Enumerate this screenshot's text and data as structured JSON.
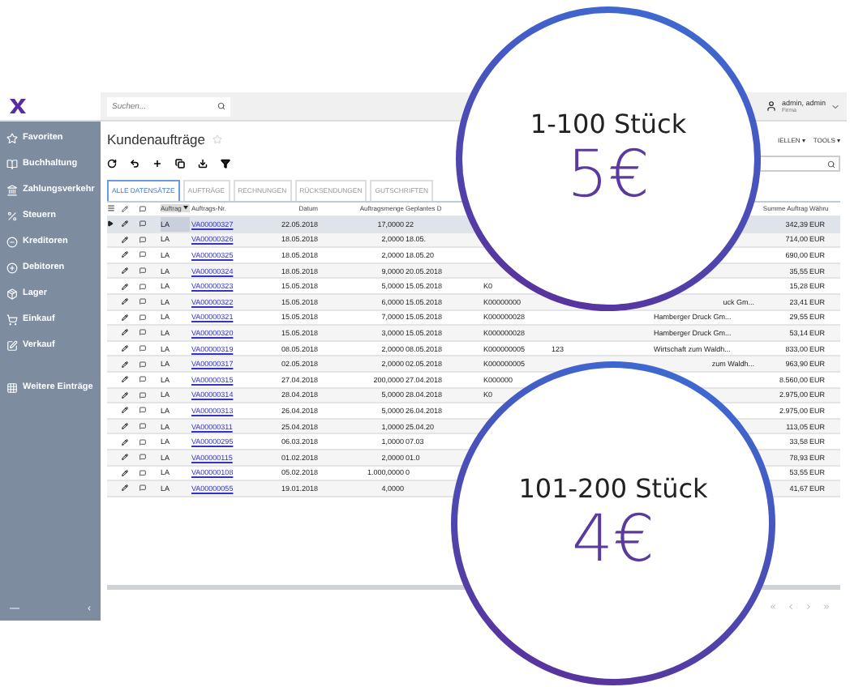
{
  "topbar": {
    "search": {
      "placeholder": "Suchen..."
    },
    "user": {
      "name": "admin, admin",
      "company": "Firma"
    }
  },
  "sidebar": {
    "items": [
      {
        "label": "Favoriten"
      },
      {
        "label": "Buchhaltung"
      },
      {
        "label": "Zahlungsverkehr"
      },
      {
        "label": "Steuern"
      },
      {
        "label": "Kreditoren"
      },
      {
        "label": "Debitoren"
      },
      {
        "label": "Lager"
      },
      {
        "label": "Einkauf"
      },
      {
        "label": "Verkauf"
      },
      {
        "label": "Weitere Einträge"
      }
    ],
    "footer": {
      "minimize": "—",
      "collapse": "‹"
    }
  },
  "page": {
    "title": "Kundenaufträge",
    "menus": [
      "IELLEN ▾",
      "TOOLS ▾"
    ]
  },
  "tabs": [
    {
      "label": "ALLE DATENSÄTZE",
      "selected": true
    },
    {
      "label": "AUFTRÄGE",
      "selected": false
    },
    {
      "label": "RECHNUNGEN",
      "selected": false
    },
    {
      "label": "RÜCKSENDUNGEN",
      "selected": false
    },
    {
      "label": "GUTSCHRIFTEN",
      "selected": false
    }
  ],
  "table": {
    "columns": [
      "Auftrag",
      "Auftrags-Nr.",
      "Datum",
      "Auftragsmenge",
      "Geplantes D",
      "Summe Auftrag",
      "Währu"
    ],
    "rows": [
      {
        "selected": true,
        "type": "LA",
        "nr": "VA00000327",
        "datum": "22.05.2018",
        "menge": "17,0000",
        "geplant": "22",
        "summe": "342,39",
        "waehrung": "EUR"
      },
      {
        "selected": false,
        "type": "LA",
        "nr": "VA00000326",
        "datum": "18.05.2018",
        "menge": "2,0000",
        "geplant": "18.05.",
        "summe": "714,00",
        "waehrung": "EUR"
      },
      {
        "selected": false,
        "type": "LA",
        "nr": "VA00000325",
        "datum": "18.05.2018",
        "menge": "2,0000",
        "geplant": "18.05.20",
        "summe": "690,00",
        "waehrung": "EUR"
      },
      {
        "selected": false,
        "type": "LA",
        "nr": "VA00000324",
        "datum": "18.05.2018",
        "menge": "9,0000",
        "geplant": "20.05.2018",
        "summe": "35,55",
        "waehrung": "EUR"
      },
      {
        "selected": false,
        "type": "LA",
        "nr": "VA00000323",
        "datum": "15.05.2018",
        "menge": "5,0000",
        "geplant": "15.05.2018",
        "kundennr": "K0",
        "summe": "15,28",
        "waehrung": "EUR"
      },
      {
        "selected": false,
        "type": "LA",
        "nr": "VA00000322",
        "datum": "15.05.2018",
        "menge": "6,0000",
        "geplant": "15.05.2018",
        "kundennr": "K00000000",
        "kunde": "uck Gm...",
        "summe": "23,41",
        "waehrung": "EUR"
      },
      {
        "selected": false,
        "type": "LA",
        "nr": "VA00000321",
        "datum": "15.05.2018",
        "menge": "7,0000",
        "geplant": "15.05.2018",
        "kundennr": "K000000028",
        "kunde": "Hamberger Druck Gm...",
        "summe": "29,55",
        "waehrung": "EUR"
      },
      {
        "selected": false,
        "type": "LA",
        "nr": "VA00000320",
        "datum": "15.05.2018",
        "menge": "3,0000",
        "geplant": "15.05.2018",
        "kundennr": "K000000028",
        "kunde": "Hamberger Druck Gm...",
        "summe": "53,14",
        "waehrung": "EUR"
      },
      {
        "selected": false,
        "type": "LA",
        "nr": "VA00000319",
        "datum": "08.05.2018",
        "menge": "2,0000",
        "geplant": "08.05.2018",
        "kundennr": "K000000005",
        "ref": "123",
        "kunde": "Wirtschaft zum Waldh...",
        "summe": "833,00",
        "waehrung": "EUR"
      },
      {
        "selected": false,
        "type": "LA",
        "nr": "VA00000317",
        "datum": "02.05.2018",
        "menge": "2,0000",
        "geplant": "02.05.2018",
        "kundennr": "K000000005",
        "kunde": "zum Waldh...",
        "summe": "963,90",
        "waehrung": "EUR"
      },
      {
        "selected": false,
        "type": "LA",
        "nr": "VA00000315",
        "datum": "27.04.2018",
        "menge": "200,0000",
        "geplant": "27.04.2018",
        "kundennr": "K000000",
        "summe": "8.560,00",
        "waehrung": "EUR"
      },
      {
        "selected": false,
        "type": "LA",
        "nr": "VA00000314",
        "datum": "28.04.2018",
        "menge": "5,0000",
        "geplant": "28.04.2018",
        "kundennr": "K0",
        "summe": "2.975,00",
        "waehrung": "EUR"
      },
      {
        "selected": false,
        "type": "LA",
        "nr": "VA00000313",
        "datum": "26.04.2018",
        "menge": "5,0000",
        "geplant": "26.04.2018",
        "summe": "2.975,00",
        "waehrung": "EUR"
      },
      {
        "selected": false,
        "type": "LA",
        "nr": "VA00000311",
        "datum": "25.04.2018",
        "menge": "1,0000",
        "geplant": "25.04.20",
        "summe": "113,05",
        "waehrung": "EUR"
      },
      {
        "selected": false,
        "type": "LA",
        "nr": "VA00000295",
        "datum": "06.03.2018",
        "menge": "1,0000",
        "geplant": "07.03",
        "summe": "33,58",
        "waehrung": "EUR"
      },
      {
        "selected": false,
        "type": "LA",
        "nr": "VA00000115",
        "datum": "01.02.2018",
        "menge": "2,0000",
        "geplant": "01.0",
        "summe": "78,93",
        "waehrung": "EUR"
      },
      {
        "selected": false,
        "type": "LA",
        "nr": "VA00000108",
        "datum": "05.02.2018",
        "menge": "1.000,0000",
        "geplant": "0",
        "summe": "53,55",
        "waehrung": "EUR"
      },
      {
        "selected": false,
        "type": "LA",
        "nr": "VA00000055",
        "datum": "19.01.2018",
        "menge": "4,0000",
        "summe": "41,67",
        "waehrung": "EUR"
      }
    ]
  },
  "offers": [
    {
      "quantity": "1-100 Stück",
      "price": "5€"
    },
    {
      "quantity": "101-200 Stück",
      "price": "4€"
    }
  ]
}
